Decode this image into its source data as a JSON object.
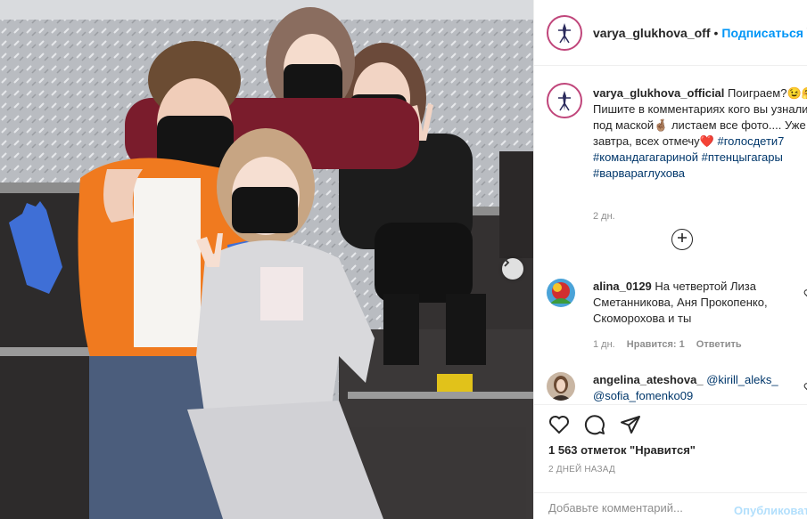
{
  "post": {
    "image_alt": "",
    "next_icon": "chevron-right-icon"
  },
  "header": {
    "username": "varya_glukhova_off",
    "dot": "•",
    "follow_label": "Подписаться",
    "more_icon": "more-icon"
  },
  "caption": {
    "username": "varya_glukhova_official",
    "text_1": " Поиграем?😉🤗 Пишите в комментариях кого вы узнали под маской🤞🏽 листаем все фото.... Уже завтра, всех отмечу❤️ ",
    "tags": [
      "#голосдети7",
      "#командагагариной",
      "#птенцыгагары",
      "#варвараглухова"
    ],
    "time": "2 дн."
  },
  "load_more_icon": "plus-circle-icon",
  "comments": [
    {
      "username": "alina_0129",
      "text": " На четвертой Лиза Сметанникова, Аня Прокопенко, Скоморохова и ты",
      "time": "1 дн.",
      "likes": "Нравится: 1",
      "reply": "Ответить"
    },
    {
      "username": "angelina_ateshova_",
      "mention_1": "@kirill_aleks_",
      "mention_2": "@sofia_fomenko09"
    }
  ],
  "actions": {
    "like_icon": "heart-icon",
    "comment_icon": "comment-icon",
    "share_icon": "send-icon"
  },
  "likes_text": "1 563 отметок \"Нравится\"",
  "date": "2 ДНЕЙ НАЗАД",
  "add_comment": {
    "placeholder": "Добавьте комментарий...",
    "publish_label": "Опубликовать"
  },
  "colors": {
    "accent": "#0095f6",
    "link": "#00376b",
    "muted": "#8e8e8e",
    "orange_jacket": "#f07a1f",
    "mask": "#141414"
  }
}
